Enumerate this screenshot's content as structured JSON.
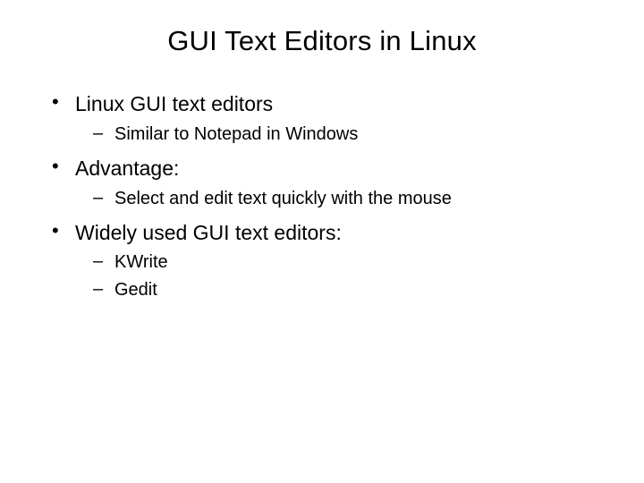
{
  "title": "GUI Text Editors in Linux",
  "bullets": [
    {
      "text": "Linux GUI text editors",
      "sub": [
        {
          "text": "Similar to Notepad in Windows"
        }
      ]
    },
    {
      "text": "Advantage:",
      "sub": [
        {
          "text": "Select and edit text quickly with the mouse"
        }
      ]
    },
    {
      "text": "Widely used GUI text editors:",
      "sub": [
        {
          "text": "KWrite"
        },
        {
          "text": "Gedit"
        }
      ]
    }
  ]
}
